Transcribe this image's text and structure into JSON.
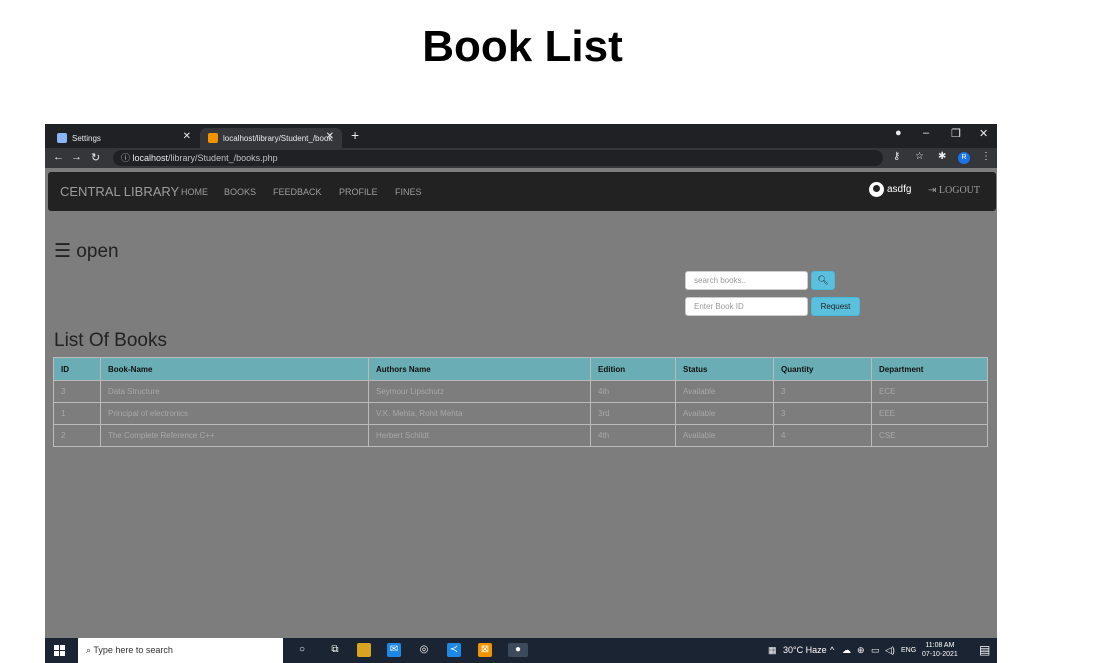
{
  "heading": "Book List",
  "browser": {
    "tab1_title": "Settings",
    "tab2_title": "localhost/library/Student_/books",
    "address_host": "localhost",
    "address_path": "/library/Student_/books.php",
    "profile_initial": "R"
  },
  "nav": {
    "brand": "CENTRAL LIBRARY",
    "links": [
      "HOME",
      "BOOKS",
      "FEEDBACK",
      "PROFILE",
      "FINES"
    ],
    "username": "asdfg",
    "logout": "LOGOUT"
  },
  "sidebar_toggle": "☰ open",
  "search": {
    "placeholder": "search books..",
    "button_icon": "search-icon"
  },
  "request": {
    "placeholder": "Enter Book ID",
    "button_label": "Request"
  },
  "list_title": "List Of Books",
  "table": {
    "columns": [
      "ID",
      "Book-Name",
      "Authors Name",
      "Edition",
      "Status",
      "Quantity",
      "Department"
    ],
    "rows": [
      [
        "3",
        "Data Structure",
        "Seymour Lipschutz",
        "4th",
        "Available",
        "3",
        "ECE"
      ],
      [
        "1",
        "Principal of electronics",
        "V.K. Mehta, Rohit Mehta",
        "3rd",
        "Available",
        "3",
        "EEE"
      ],
      [
        "2",
        "The Complete Reference C++",
        "Herbert Schildt",
        "4th",
        "Available",
        "4",
        "CSE"
      ]
    ]
  },
  "taskbar": {
    "search_placeholder": "Type here to search",
    "weather": "30°C Haze",
    "language": "ENG",
    "time": "11:08 AM",
    "date": "07-10-2021"
  },
  "colors": {
    "table_header": "#6aadb5",
    "button": "#5bc0de",
    "page_bg": "#7d7d7d",
    "navbar": "#222222"
  }
}
